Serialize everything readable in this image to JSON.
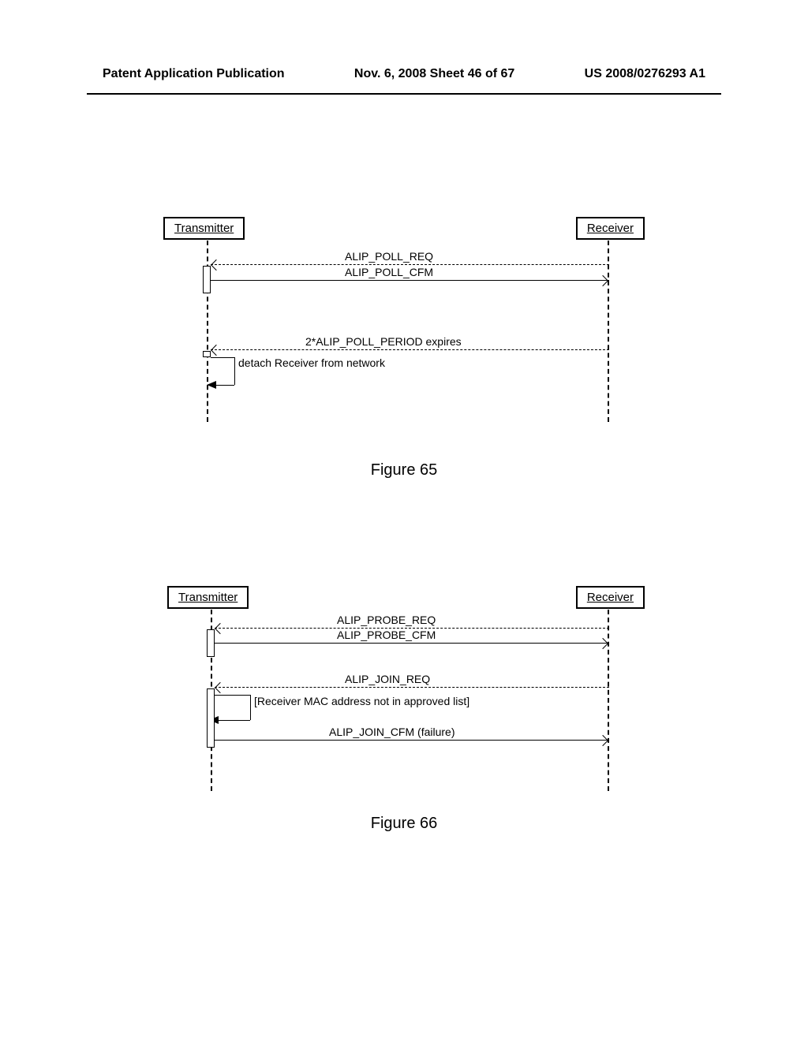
{
  "header": {
    "left": "Patent Application Publication",
    "center": "Nov. 6, 2008  Sheet 46 of 67",
    "right": "US 2008/0276293 A1"
  },
  "figure65": {
    "transmitter": "Transmitter",
    "receiver": "Receiver",
    "msg1": "ALIP_POLL_REQ",
    "msg2": "ALIP_POLL_CFM",
    "msg3": "2*ALIP_POLL_PERIOD expires",
    "msg4": "detach Receiver from network",
    "caption": "Figure 65"
  },
  "figure66": {
    "transmitter": "Transmitter",
    "receiver": "Receiver",
    "msg1": "ALIP_PROBE_REQ",
    "msg2": "ALIP_PROBE_CFM",
    "msg3": "ALIP_JOIN_REQ",
    "msg4": "[Receiver MAC address not in approved list]",
    "msg5": "ALIP_JOIN_CFM (failure)",
    "caption": "Figure 66"
  }
}
